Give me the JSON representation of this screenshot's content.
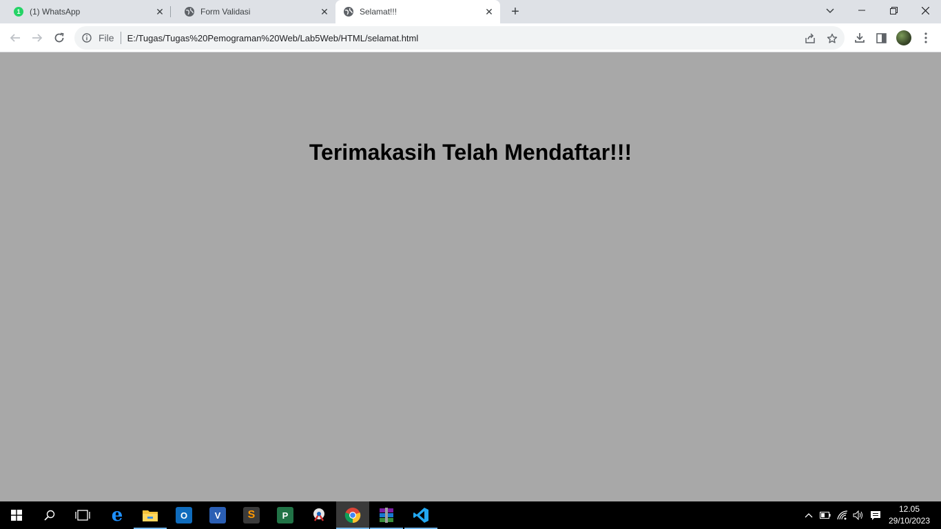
{
  "browser": {
    "tabs": [
      {
        "title": "(1) WhatsApp",
        "badge": "1",
        "icon": "whatsapp-icon",
        "active": false
      },
      {
        "title": "Form Validasi",
        "icon": "globe-icon",
        "active": false
      },
      {
        "title": "Selamat!!!",
        "icon": "globe-icon",
        "active": true
      }
    ],
    "omnibox": {
      "scheme_label": "File",
      "url": "E:/Tugas/Tugas%20Pemograman%20Web/Lab5Web/HTML/selamat.html"
    }
  },
  "page": {
    "heading": "Terimakasih Telah Mendaftar!!!",
    "background_color": "#a8a8a8"
  },
  "taskbar": {
    "apps": [
      "start-icon",
      "search-icon",
      "task-view-icon",
      "edge-icon",
      "file-explorer-icon",
      "outlook-icon",
      "visio-icon",
      "sublime-text-icon",
      "project-icon",
      "snipping-tool-icon",
      "chrome-icon",
      "winrar-icon",
      "vscode-icon"
    ],
    "clock": {
      "time": "12.05",
      "date": "29/10/2023"
    }
  }
}
